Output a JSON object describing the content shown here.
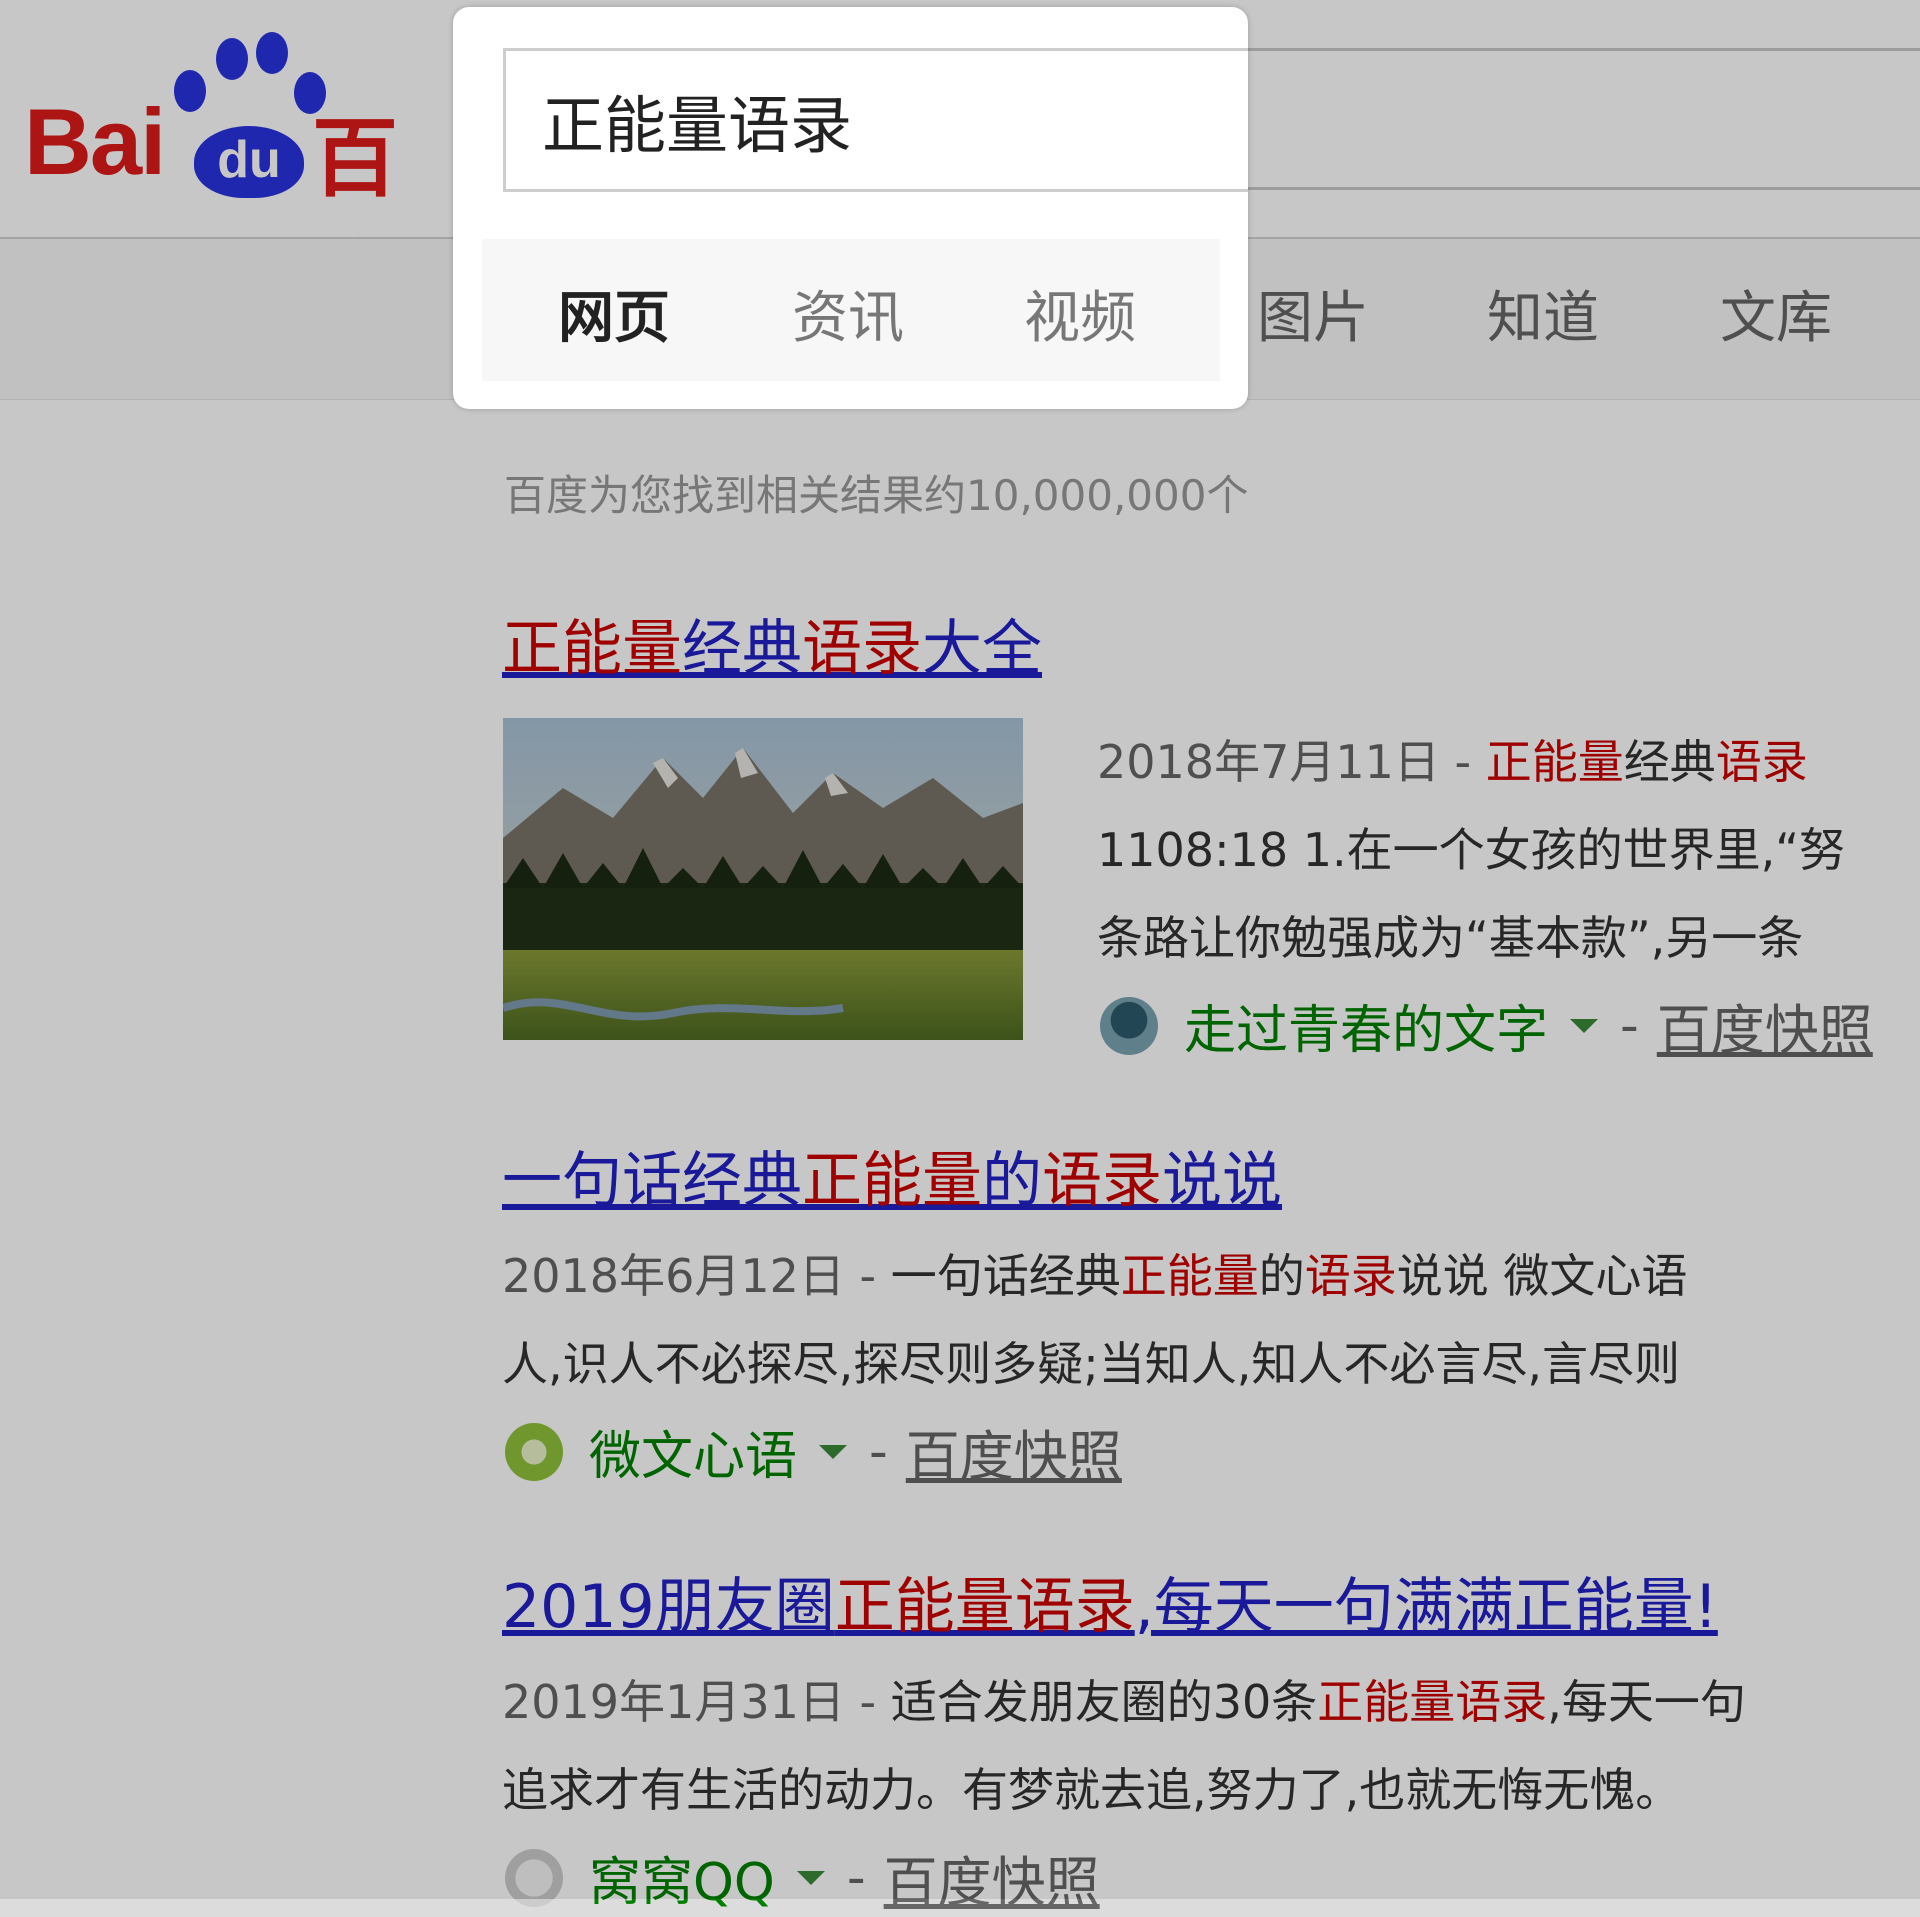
{
  "search": {
    "query": "正能量语录"
  },
  "tabs": [
    "网页",
    "资讯",
    "视频",
    "图片",
    "知道",
    "文库"
  ],
  "result_count": "百度为您找到相关结果约10,000,000个",
  "results": [
    {
      "title_parts": [
        "正能量",
        "经典",
        "语录",
        "大全"
      ],
      "date": "2018年7月11日 - ",
      "line1_em1": "正能量",
      "line1_mid": "经典",
      "line1_em2": "语录",
      "line2": "1108:18 1.在一个女孩的世界里,“努",
      "line3": "条路让你勉强成为“基本款”,另一条",
      "source": "走过青春的文字",
      "snapshot": "百度快照"
    },
    {
      "title_parts": [
        "一句话经典",
        "正能量",
        "的",
        "语录",
        "说说"
      ],
      "date": "2018年6月12日 - ",
      "line1_pre": "一句话经典",
      "line1_em1": "正能量",
      "line1_mid": "的",
      "line1_em2": "语录",
      "line1_post": "说说 微文心语",
      "line2": "人,识人不必探尽,探尽则多疑;当知人,知人不必言尽,言尽则",
      "source": "微文心语",
      "snapshot": "百度快照"
    },
    {
      "title_parts": [
        "2019朋友圈",
        "正能量语录",
        ",每天一句满满正能量!"
      ],
      "date": "2019年1月31日 - ",
      "line1_pre": "适合发朋友圈的30条",
      "line1_em": "正能量语录",
      "line1_post": ",每天一句",
      "line2": "追求才有生活的动力。有梦就去追,努力了,也就无悔无愧。",
      "source": "窝窝QQ",
      "snapshot": "百度快照"
    }
  ],
  "colors": {
    "brand_red": "#de1a1a",
    "brand_blue": "#2932e1",
    "link": "#2121c6",
    "highlight": "#cc0000",
    "source_green": "#008000"
  }
}
